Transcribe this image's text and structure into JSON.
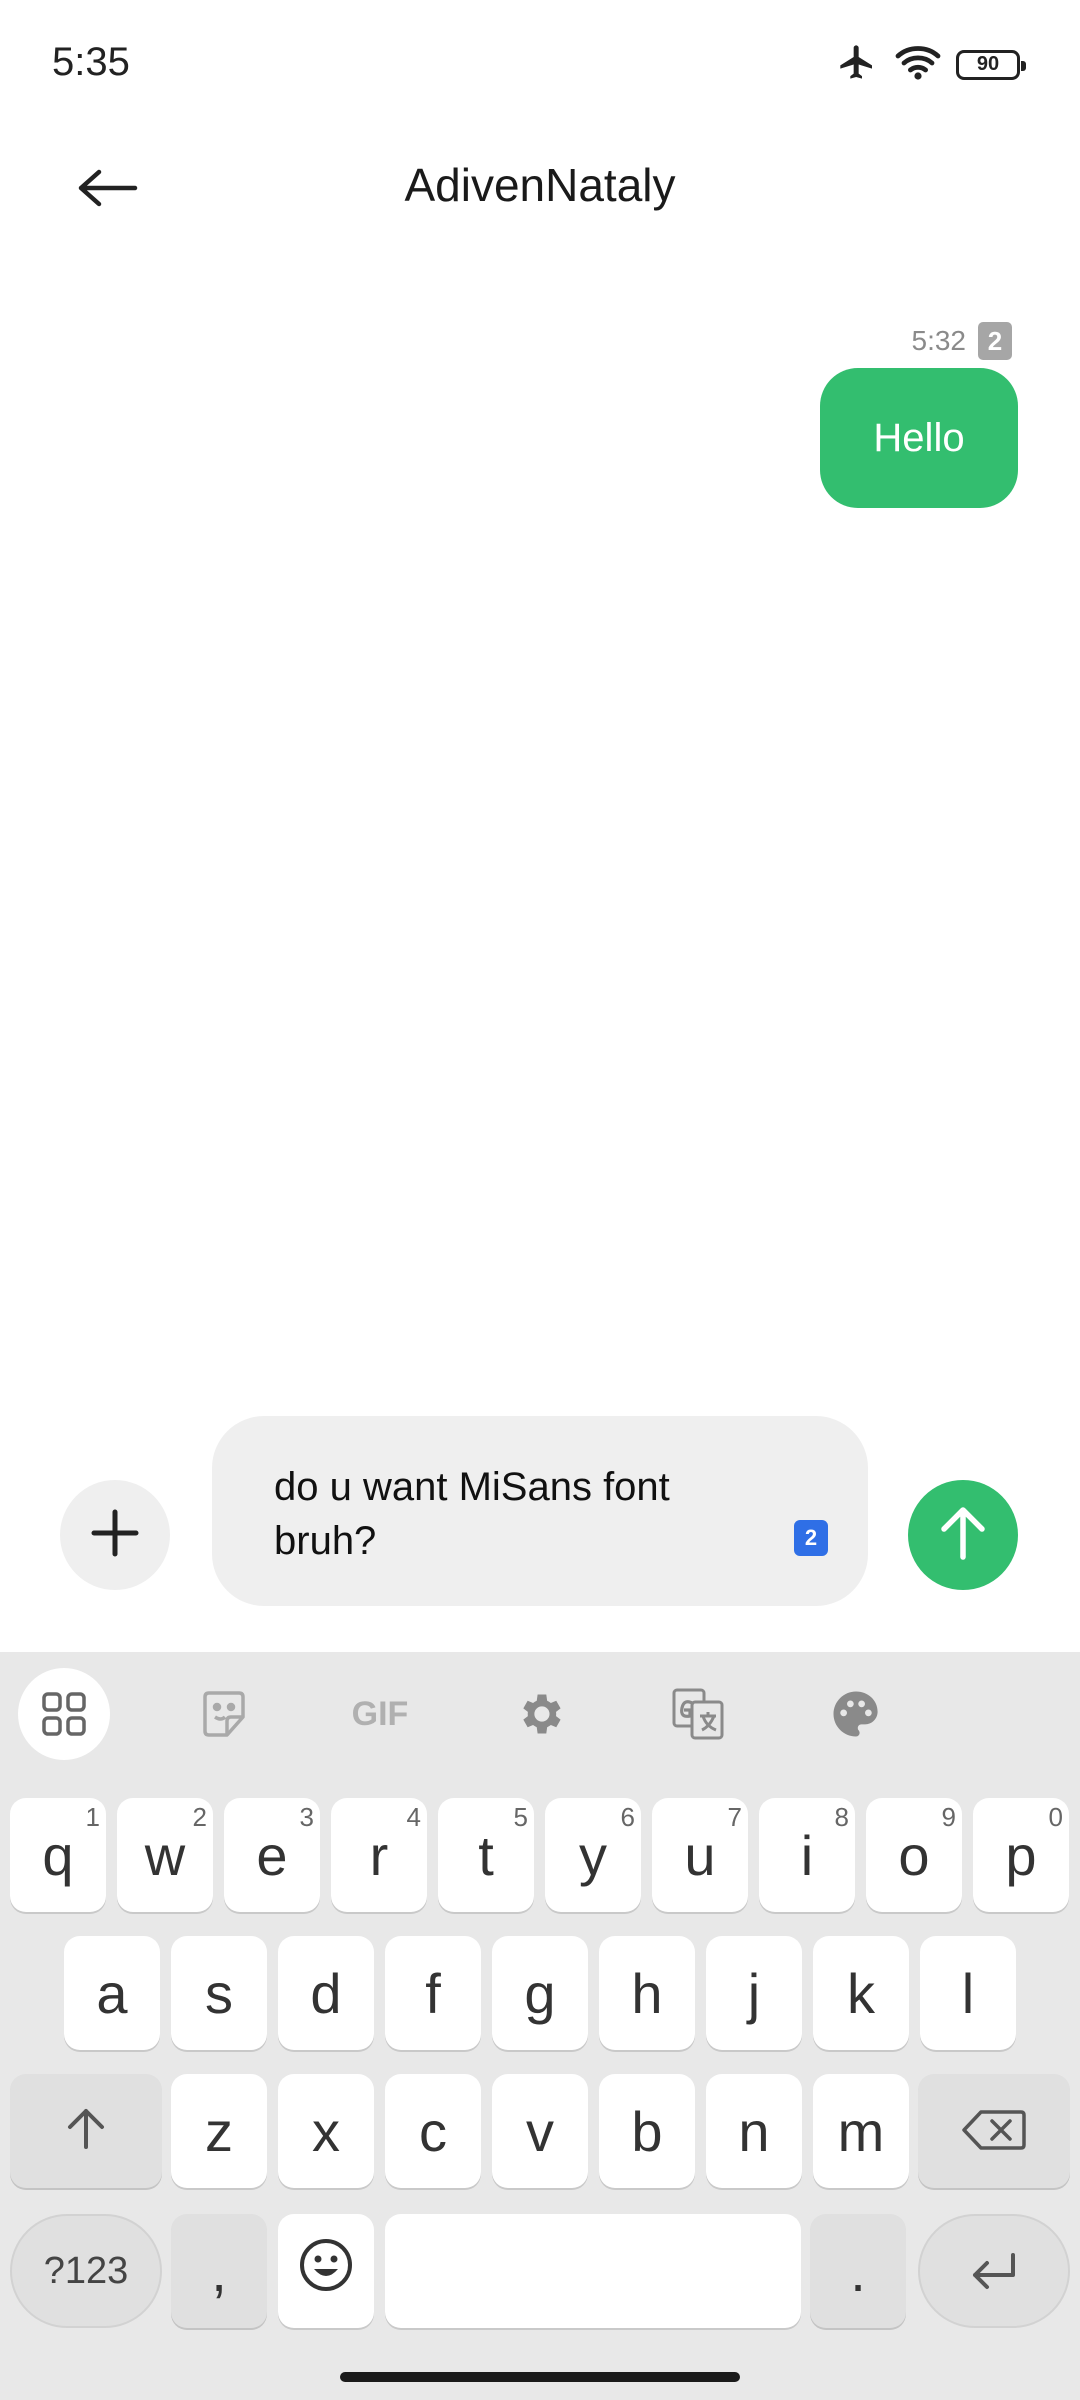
{
  "status_bar": {
    "time": "5:35",
    "battery": "90",
    "icons": [
      "airplane-icon",
      "wifi-icon",
      "battery-icon"
    ]
  },
  "header": {
    "title": "AdivenNataly",
    "back_icon": "arrow-left-icon"
  },
  "messages": [
    {
      "direction": "outgoing",
      "time": "5:32",
      "sim": "2",
      "text": "Hello",
      "color": "#33be6f"
    }
  ],
  "composer": {
    "text": "do u want MiSans font bruh?",
    "sim": "2",
    "add_icon": "plus-icon",
    "send_icon": "arrow-up-icon",
    "send_color": "#33be6f"
  },
  "keyboard": {
    "toolbar": [
      "apps-grid-icon",
      "sticker-icon",
      "gif-icon",
      "settings-icon",
      "translate-icon",
      "palette-icon"
    ],
    "gif_label": "GIF",
    "row1": [
      {
        "key": "q",
        "hint": "1"
      },
      {
        "key": "w",
        "hint": "2"
      },
      {
        "key": "e",
        "hint": "3"
      },
      {
        "key": "r",
        "hint": "4"
      },
      {
        "key": "t",
        "hint": "5"
      },
      {
        "key": "y",
        "hint": "6"
      },
      {
        "key": "u",
        "hint": "7"
      },
      {
        "key": "i",
        "hint": "8"
      },
      {
        "key": "o",
        "hint": "9"
      },
      {
        "key": "p",
        "hint": "0"
      }
    ],
    "row2": [
      "a",
      "s",
      "d",
      "f",
      "g",
      "h",
      "j",
      "k",
      "l"
    ],
    "row3": [
      "z",
      "x",
      "c",
      "v",
      "b",
      "n",
      "m"
    ],
    "row4": {
      "symbols": "?123",
      "comma": ",",
      "period": "."
    }
  }
}
